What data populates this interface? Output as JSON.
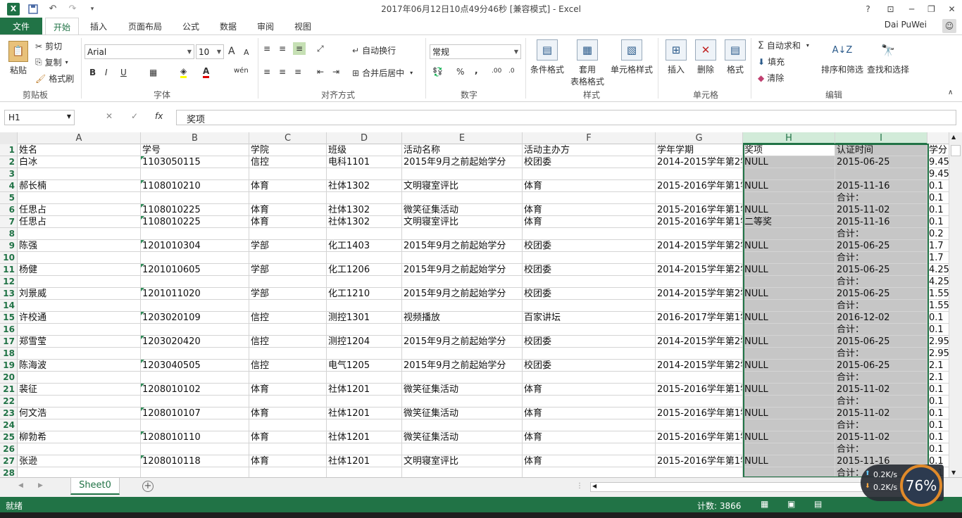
{
  "window": {
    "title": "2017年06月12日10点49分46秒  [兼容模式] - Excel",
    "help": "?",
    "controls": [
      "─",
      "❐",
      "✕"
    ]
  },
  "tabs": [
    "文件",
    "开始",
    "插入",
    "页面布局",
    "公式",
    "数据",
    "审阅",
    "视图"
  ],
  "user": "Dai PuWei",
  "ribbon": {
    "clipboard": {
      "paste": "粘贴",
      "cut": "剪切",
      "copy": "复制",
      "format_painter": "格式刷",
      "label": "剪贴板"
    },
    "font": {
      "name": "Arial",
      "size": "10",
      "label": "字体",
      "bold": "B",
      "italic": "I",
      "underline": "U",
      "grow": "A",
      "shrink": "A",
      "wen": "wén"
    },
    "alignment": {
      "wrap": "自动换行",
      "merge": "合并后居中",
      "label": "对齐方式"
    },
    "number": {
      "format": "常规",
      "label": "数字",
      "percent": "%",
      "comma": ","
    },
    "styles": {
      "cond": "条件格式",
      "table": "套用",
      "table2": "表格格式",
      "cell": "单元格样式",
      "label": "样式"
    },
    "cells": {
      "insert": "插入",
      "delete": "删除",
      "format": "格式",
      "label": "单元格"
    },
    "editing": {
      "autosum": "自动求和",
      "fill": "填充",
      "clear": "清除",
      "sort": "排序和筛选",
      "find": "查找和选择",
      "label": "编辑"
    }
  },
  "formula_bar": {
    "name_box": "H1",
    "formula": "奖项",
    "fx": "fx"
  },
  "columns": [
    "A",
    "B",
    "C",
    "D",
    "E",
    "F",
    "G",
    "H",
    "I"
  ],
  "selected_columns": [
    "H",
    "I"
  ],
  "rows": [
    {
      "n": "1",
      "cells": [
        "姓名",
        "学号",
        "学院",
        "班级",
        "活动名称",
        "活动主办方",
        "学年学期",
        "奖项",
        "认证时间",
        "学分"
      ]
    },
    {
      "n": "2",
      "cells": [
        "白冰",
        "1103050115",
        "信控",
        "电科1101",
        "2015年9月之前起始学分",
        "校团委",
        "2014-2015学年第2学",
        "NULL",
        "2015-06-25",
        "9.45"
      ]
    },
    {
      "n": "3",
      "cells": [
        "",
        "",
        "",
        "",
        "",
        "",
        "",
        "",
        "",
        "9.45"
      ]
    },
    {
      "n": "4",
      "cells": [
        "郝长楠",
        "1108010210",
        "体育",
        "社体1302",
        "文明寝室评比",
        "体育",
        "2015-2016学年第1学",
        "NULL",
        "2015-11-16",
        "0.1"
      ]
    },
    {
      "n": "5",
      "cells": [
        "",
        "",
        "",
        "",
        "",
        "",
        "",
        "",
        "合计：",
        "0.1"
      ]
    },
    {
      "n": "6",
      "cells": [
        "任思占",
        "1108010225",
        "体育",
        "社体1302",
        "微笑征集活动",
        "体育",
        "2015-2016学年第1学",
        "NULL",
        "2015-11-02",
        "0.1"
      ]
    },
    {
      "n": "7",
      "cells": [
        "任思占",
        "1108010225",
        "体育",
        "社体1302",
        "文明寝室评比",
        "体育",
        "2015-2016学年第1学",
        "二等奖",
        "2015-11-16",
        "0.1"
      ]
    },
    {
      "n": "8",
      "cells": [
        "",
        "",
        "",
        "",
        "",
        "",
        "",
        "",
        "合计：",
        "0.2"
      ]
    },
    {
      "n": "9",
      "cells": [
        "陈强",
        "1201010304",
        "学部",
        "化工1403",
        "2015年9月之前起始学分",
        "校团委",
        "2014-2015学年第2学",
        "NULL",
        "2015-06-25",
        "1.7"
      ]
    },
    {
      "n": "10",
      "cells": [
        "",
        "",
        "",
        "",
        "",
        "",
        "",
        "",
        "合计：",
        "1.7"
      ]
    },
    {
      "n": "11",
      "cells": [
        "杨健",
        "1201010605",
        "学部",
        "化工1206",
        "2015年9月之前起始学分",
        "校团委",
        "2014-2015学年第2学",
        "NULL",
        "2015-06-25",
        "4.25"
      ]
    },
    {
      "n": "12",
      "cells": [
        "",
        "",
        "",
        "",
        "",
        "",
        "",
        "",
        "合计：",
        "4.25"
      ]
    },
    {
      "n": "13",
      "cells": [
        "刘景威",
        "1201011020",
        "学部",
        "化工1210",
        "2015年9月之前起始学分",
        "校团委",
        "2014-2015学年第2学",
        "NULL",
        "2015-06-25",
        "1.55"
      ]
    },
    {
      "n": "14",
      "cells": [
        "",
        "",
        "",
        "",
        "",
        "",
        "",
        "",
        "合计：",
        "1.55"
      ]
    },
    {
      "n": "15",
      "cells": [
        "许校通",
        "1203020109",
        "信控",
        "测控1301",
        "视频播放",
        "百家讲坛",
        "2016-2017学年第1学",
        "NULL",
        "2016-12-02",
        "0.1"
      ]
    },
    {
      "n": "16",
      "cells": [
        "",
        "",
        "",
        "",
        "",
        "",
        "",
        "",
        "合计：",
        "0.1"
      ]
    },
    {
      "n": "17",
      "cells": [
        "郑雪莹",
        "1203020420",
        "信控",
        "测控1204",
        "2015年9月之前起始学分",
        "校团委",
        "2014-2015学年第2学",
        "NULL",
        "2015-06-25",
        "2.95"
      ]
    },
    {
      "n": "18",
      "cells": [
        "",
        "",
        "",
        "",
        "",
        "",
        "",
        "",
        "合计：",
        "2.95"
      ]
    },
    {
      "n": "19",
      "cells": [
        "陈海波",
        "1203040505",
        "信控",
        "电气1205",
        "2015年9月之前起始学分",
        "校团委",
        "2014-2015学年第2学",
        "NULL",
        "2015-06-25",
        "2.1"
      ]
    },
    {
      "n": "20",
      "cells": [
        "",
        "",
        "",
        "",
        "",
        "",
        "",
        "",
        "合计：",
        "2.1"
      ]
    },
    {
      "n": "21",
      "cells": [
        "裴征",
        "1208010102",
        "体育",
        "社体1201",
        "微笑征集活动",
        "体育",
        "2015-2016学年第1学",
        "NULL",
        "2015-11-02",
        "0.1"
      ]
    },
    {
      "n": "22",
      "cells": [
        "",
        "",
        "",
        "",
        "",
        "",
        "",
        "",
        "合计：",
        "0.1"
      ]
    },
    {
      "n": "23",
      "cells": [
        "何文浩",
        "1208010107",
        "体育",
        "社体1201",
        "微笑征集活动",
        "体育",
        "2015-2016学年第1学",
        "NULL",
        "2015-11-02",
        "0.1"
      ]
    },
    {
      "n": "24",
      "cells": [
        "",
        "",
        "",
        "",
        "",
        "",
        "",
        "",
        "合计：",
        "0.1"
      ]
    },
    {
      "n": "25",
      "cells": [
        "柳勃希",
        "1208010110",
        "体育",
        "社体1201",
        "微笑征集活动",
        "体育",
        "2015-2016学年第1学",
        "NULL",
        "2015-11-02",
        "0.1"
      ]
    },
    {
      "n": "26",
      "cells": [
        "",
        "",
        "",
        "",
        "",
        "",
        "",
        "",
        "合计：",
        "0.1"
      ]
    },
    {
      "n": "27",
      "cells": [
        "张逊",
        "1208010118",
        "体育",
        "社体1201",
        "文明寝室评比",
        "体育",
        "2015-2016学年第1学",
        "NULL",
        "2015-11-16",
        "0.1"
      ]
    },
    {
      "n": "28",
      "cells": [
        "",
        "",
        "",
        "",
        "",
        "",
        "",
        "",
        "合计：",
        "0.1"
      ]
    }
  ],
  "sheet_tab": "Sheet0",
  "status": {
    "ready": "就绪",
    "count": "计数: 3866"
  },
  "network": {
    "up": "0.2K/s",
    "down": "0.2K/s",
    "percent": "76%"
  },
  "colors": {
    "accent": "#217346",
    "selection_fill": "#c6c6c6"
  },
  "icons": [
    "excel-logo-icon",
    "save-icon",
    "undo-icon",
    "redo-icon",
    "paste-icon",
    "cut-icon",
    "copy-icon",
    "format-painter-icon",
    "sum-icon",
    "sort-icon",
    "find-icon"
  ]
}
